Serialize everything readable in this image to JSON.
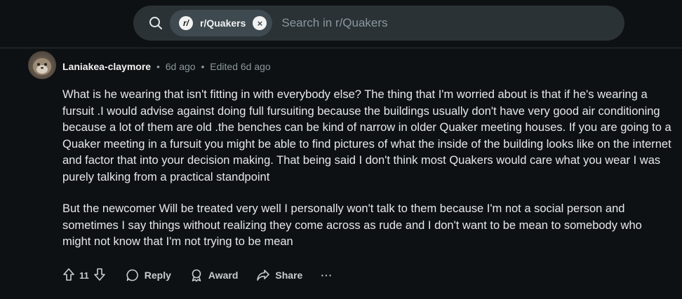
{
  "search": {
    "icon": "search-icon",
    "chip_icon_glyph": "r/",
    "chip_label": "r/Quakers",
    "chip_close_glyph": "×",
    "placeholder": "Search in r/Quakers"
  },
  "comment": {
    "author": "Laniakea-claymore",
    "dot": "•",
    "time": "6d ago",
    "edited": "Edited 6d ago",
    "paragraphs": [
      "What is he wearing that isn't fitting in with everybody else? The thing that I'm worried about is that if he's wearing a fursuit .I would advise against doing full fursuiting because the buildings usually don't have very good air conditioning because a lot of them are old .the benches can be kind of narrow in older Quaker meeting houses. If you are going to a Quaker meeting in a fursuit you might be able to find pictures of what the inside of the building looks like on the internet and factor that into your decision making. That being said I don't think most Quakers would care what you wear I was purely talking from a practical standpoint",
      "But the newcomer Will be treated very well I personally won't talk to them because I'm not a social person and sometimes I say things without realizing they come across as rude and I don't want to be mean to somebody who might not know that I'm not trying to be mean"
    ],
    "actions": {
      "vote_count": "11",
      "reply": "Reply",
      "award": "Award",
      "share": "Share",
      "more": "···"
    }
  },
  "colors": {
    "background": "#0e1113",
    "search_bg": "#2a3236",
    "chip_bg": "#3e4a50",
    "muted_text": "#8a979d"
  }
}
